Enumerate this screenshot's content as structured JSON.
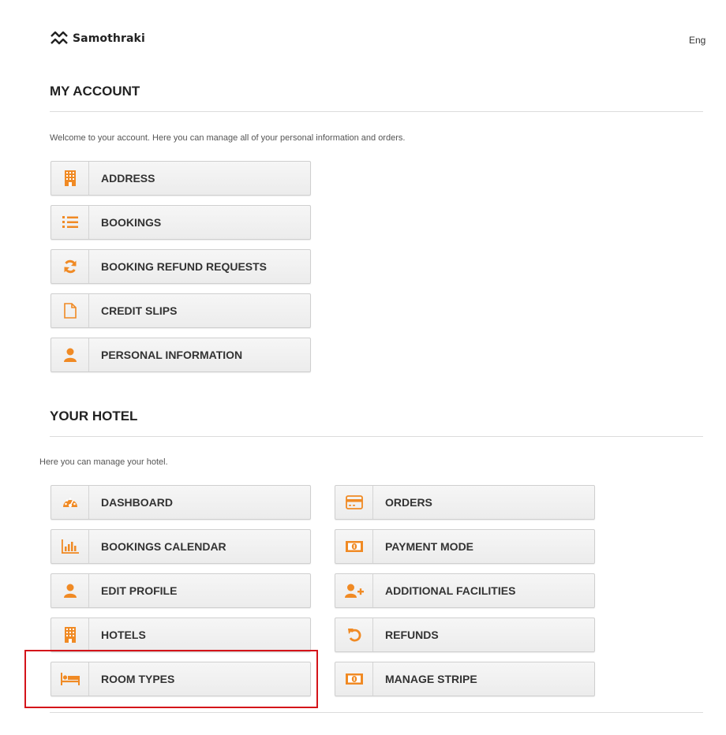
{
  "header": {
    "brand": "Samothraki",
    "language": "Eng"
  },
  "account": {
    "title": "MY ACCOUNT",
    "intro": "Welcome to your account. Here you can manage all of your personal information and orders.",
    "items": [
      {
        "label": "ADDRESS",
        "icon": "building-icon"
      },
      {
        "label": "BOOKINGS",
        "icon": "ordered-list-icon"
      },
      {
        "label": "BOOKING REFUND REQUESTS",
        "icon": "refresh-icon"
      },
      {
        "label": "CREDIT SLIPS",
        "icon": "file-icon"
      },
      {
        "label": "PERSONAL INFORMATION",
        "icon": "user-icon"
      }
    ]
  },
  "hotel": {
    "title": "YOUR HOTEL",
    "intro": "Here you can manage your hotel.",
    "left": [
      {
        "label": "DASHBOARD",
        "icon": "dashboard-icon"
      },
      {
        "label": "BOOKINGS CALENDAR",
        "icon": "bar-chart-icon"
      },
      {
        "label": "EDIT PROFILE",
        "icon": "user-icon"
      },
      {
        "label": "HOTELS",
        "icon": "building-icon"
      },
      {
        "label": "ROOM TYPES",
        "icon": "bed-icon"
      }
    ],
    "right": [
      {
        "label": "ORDERS",
        "icon": "credit-card-icon"
      },
      {
        "label": "PAYMENT MODE",
        "icon": "money-icon"
      },
      {
        "label": "ADDITIONAL FACILITIES",
        "icon": "user-plus-icon"
      },
      {
        "label": "REFUNDS",
        "icon": "undo-icon"
      },
      {
        "label": "MANAGE STRIPE",
        "icon": "money-icon"
      }
    ]
  },
  "colors": {
    "accent": "#f08a24",
    "highlight": "#d4141a"
  }
}
